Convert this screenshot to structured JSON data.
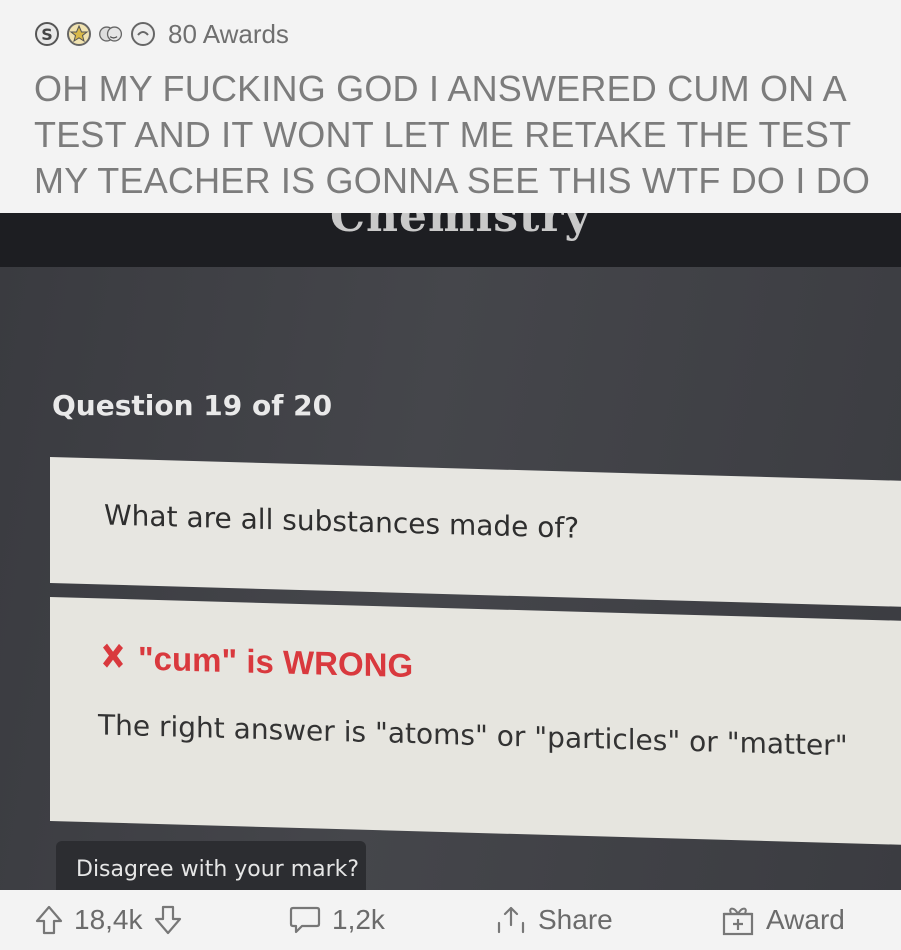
{
  "header": {
    "awards_label": "80 Awards",
    "award_icons": [
      "silver-award-icon",
      "gold-award-icon",
      "wholesome-award-icon",
      "helpful-award-icon"
    ]
  },
  "post": {
    "title": "OH MY FUCKING GOD I ANSWERED CUM ON A TEST AND IT WONT LET ME RETAKE THE TEST MY TEACHER IS GONNA SEE THIS WTF DO I DO"
  },
  "photo": {
    "top_text": "Chemistry",
    "question_number_label": "Question 19 of 20",
    "question_text": "What are all substances made of?",
    "wrong_text": "\"cum\" is WRONG",
    "right_answer_text": "The right answer is \"atoms\" or \"particles\" or \"matter\"",
    "disagree_label": "Disagree with your mark?"
  },
  "actions": {
    "upvotes": "18,4k",
    "comments": "1,2k",
    "share_label": "Share",
    "award_label": "Award"
  },
  "colors": {
    "wrong_red": "#d9393e",
    "page_bg": "#f3f3f3"
  }
}
